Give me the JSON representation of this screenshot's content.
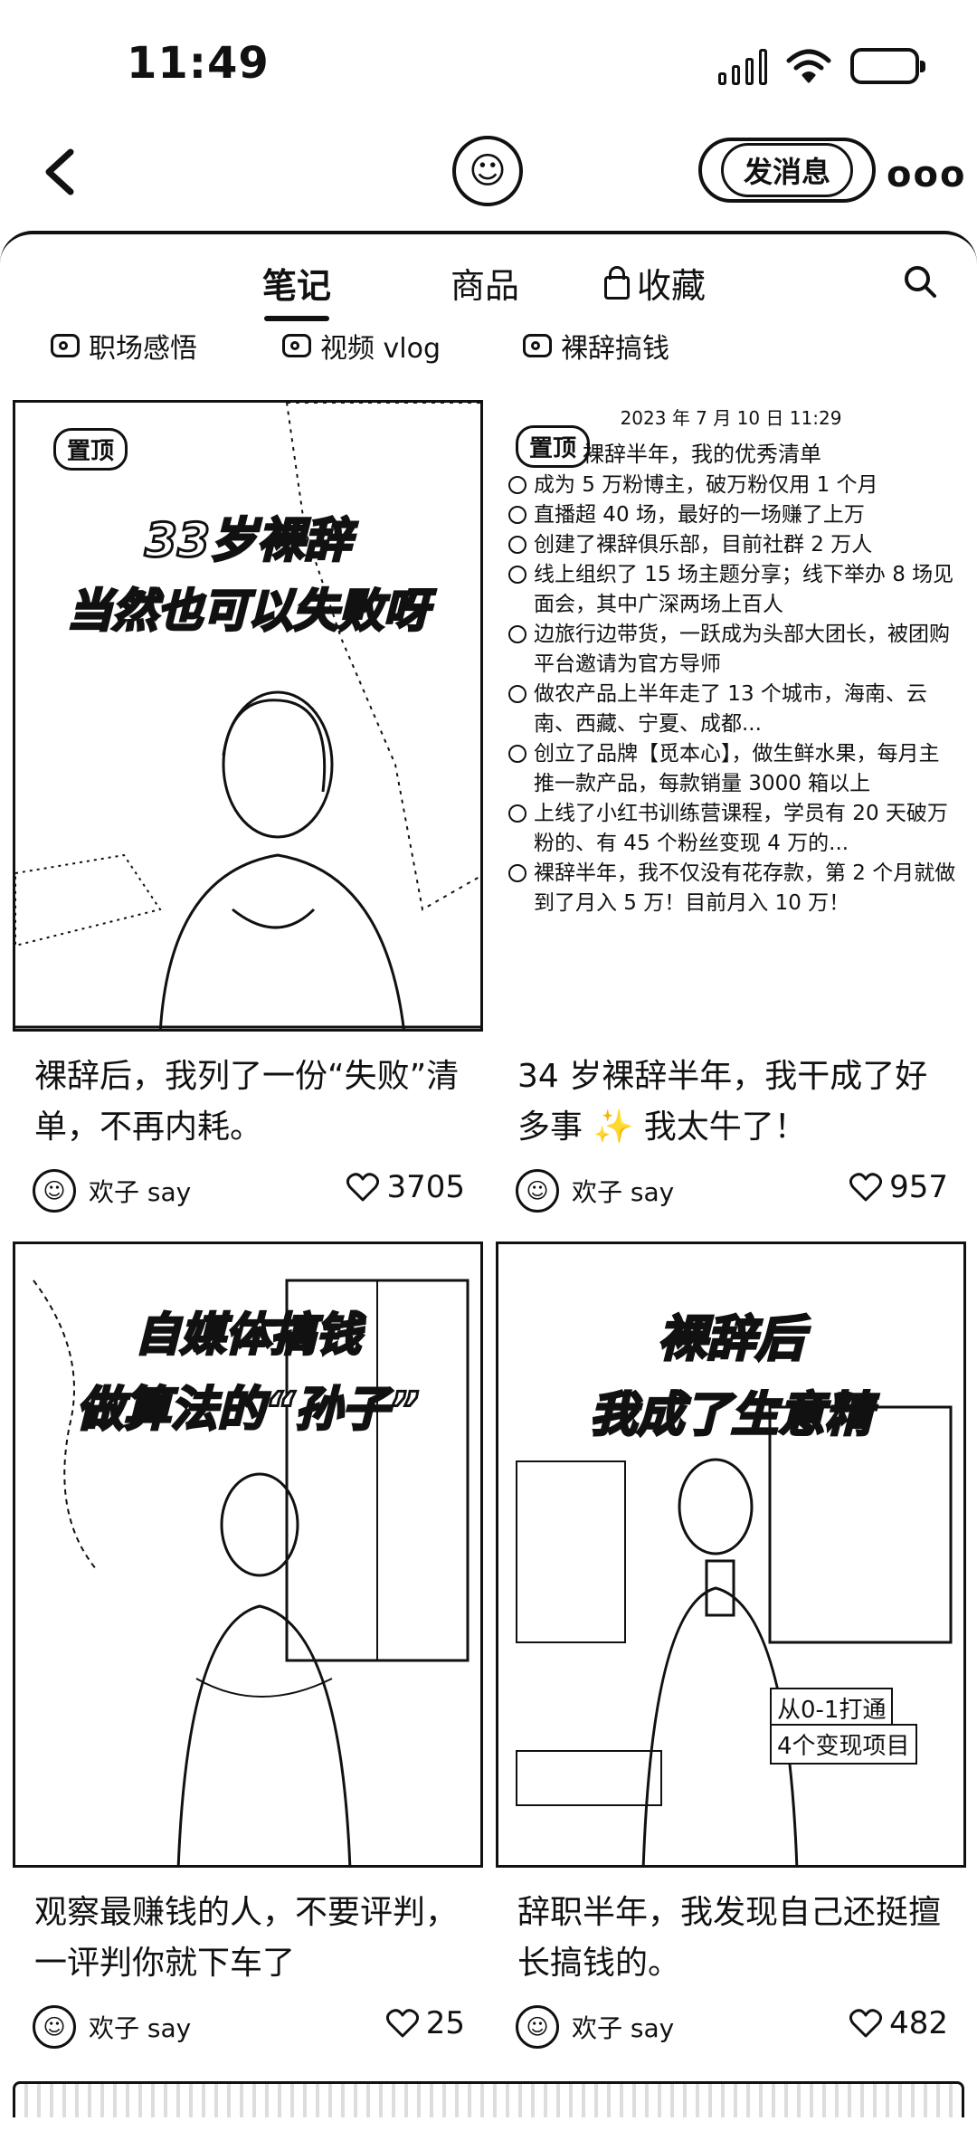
{
  "status": {
    "time": "11:49"
  },
  "header": {
    "message_button": "发消息",
    "more": "ooo"
  },
  "tabs": [
    {
      "label": "笔记"
    },
    {
      "label": "商品"
    },
    {
      "label": "收藏"
    }
  ],
  "chips": [
    {
      "label": "职场感悟"
    },
    {
      "label": "视频 vlog"
    },
    {
      "label": "裸辞搞钱"
    }
  ],
  "posts": [
    {
      "pin": "置顶",
      "cover_lines": [
        "33岁裸辞",
        "当然也可以失败呀"
      ],
      "title": "裸辞后，我列了一份“失败”清单，不再内耗。",
      "author": "欢子 say",
      "likes": "3705"
    },
    {
      "pin": "置顶",
      "list_date": "2023 年 7 月 10 日  11:29",
      "list_head": "裸辞半年，我的优秀清单",
      "list_items": [
        "成为 5 万粉博主，破万粉仅用 1 个月",
        "直播超 40 场，最好的一场赚了上万",
        "创建了裸辞俱乐部，目前社群 2 万人",
        "线上组织了 15 场主题分享；线下举办 8 场见面会，其中广深两场上百人",
        "边旅行边带货，一跃成为头部大团长，被团购平台邀请为官方导师",
        "做农产品上半年走了 13 个城市，海南、云南、西藏、宁夏、成都...",
        "创立了品牌【觅本心】，做生鲜水果，每月主推一款产品，每款销量 3000 箱以上",
        "上线了小红书训练营课程，学员有 20 天破万粉的、有 45 个粉丝变现 4 万的...",
        "裸辞半年，我不仅没有花存款，第 2 个月就做到了月入 5 万！目前月入 10 万！"
      ],
      "title": "34 岁裸辞半年，我干成了好多事 ✨ 我太牛了！",
      "author": "欢子 say",
      "likes": "957"
    },
    {
      "cover_lines": [
        "自媒体搞钱",
        "做算法的“孙子”"
      ],
      "title": "观察最赚钱的人，不要评判，一评判你就下车了",
      "author": "欢子 say",
      "likes": "25"
    },
    {
      "cover_lines": [
        "裸辞后",
        "我成了生意精"
      ],
      "tags": [
        "从0-1打通",
        "4个变现项目"
      ],
      "title": "辞职半年，我发现自己还挺擅长搞钱的。",
      "author": "欢子 say",
      "likes": "482"
    }
  ]
}
